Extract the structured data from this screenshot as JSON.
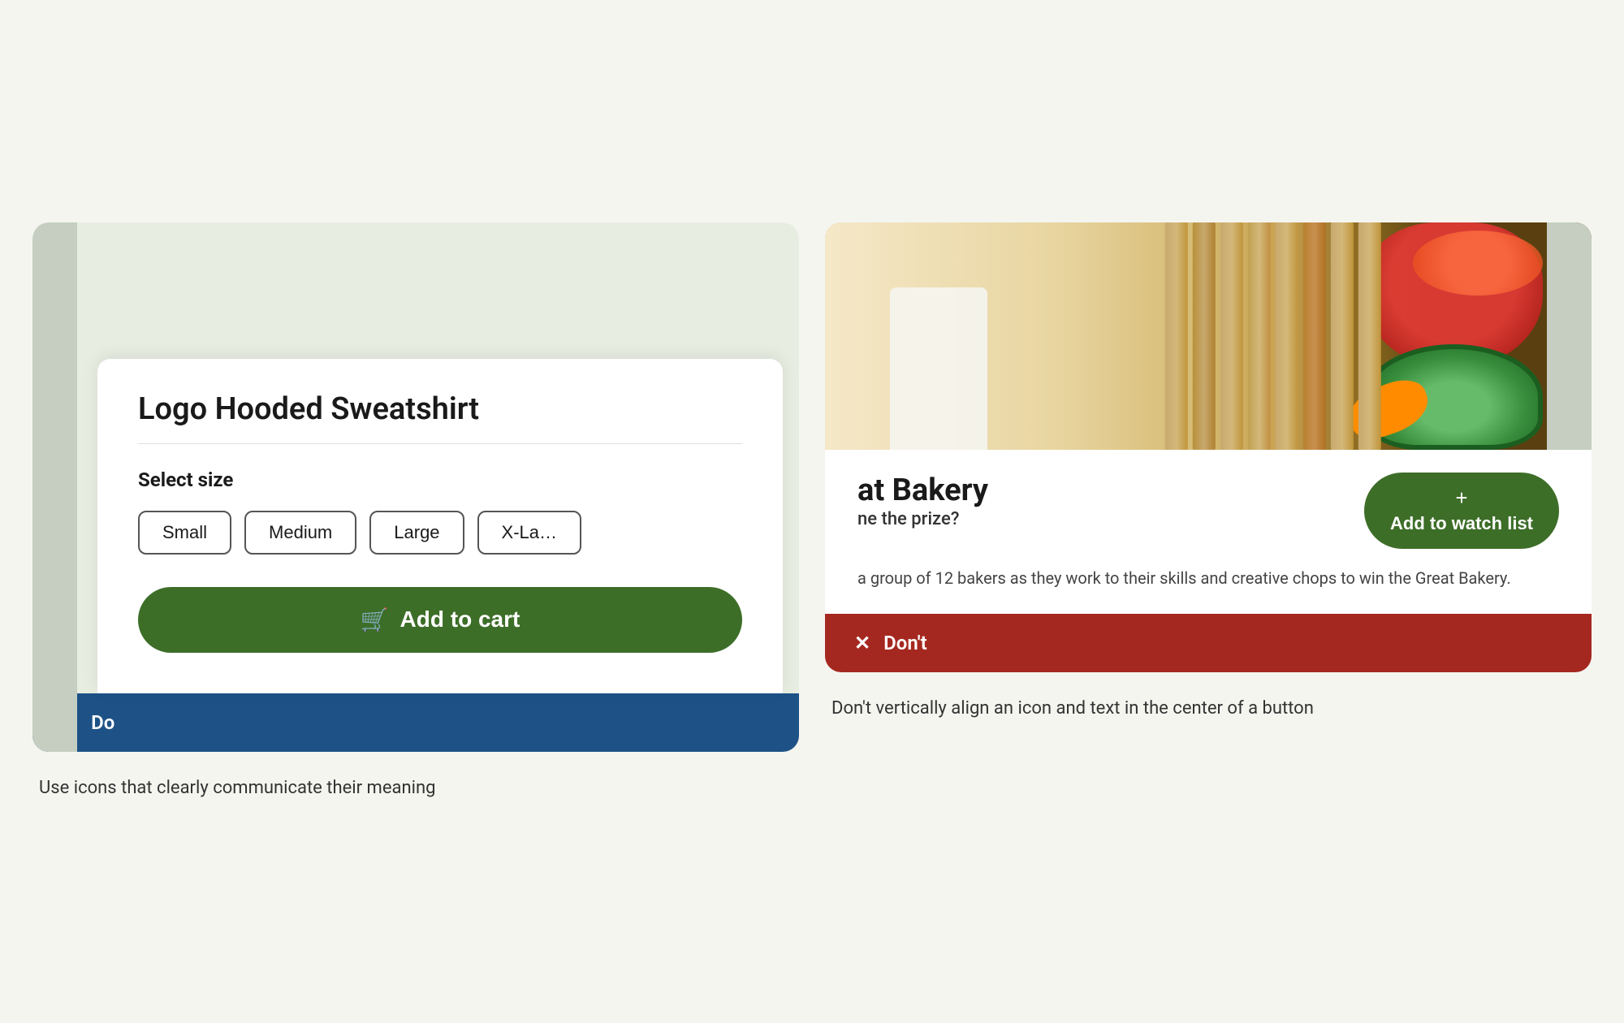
{
  "left_panel": {
    "card": {
      "product_title": "Logo Hooded Sweatshirt",
      "select_size_label": "Select size",
      "sizes": [
        "Small",
        "Medium",
        "Large",
        "X-La…"
      ],
      "add_to_cart_label": "Add to cart",
      "cart_icon": "🛒"
    },
    "label_bar": {
      "icon": "✓",
      "text": "Do"
    },
    "description": "Use icons that clearly communicate their meaning"
  },
  "right_panel": {
    "card": {
      "bakery_title": "at Bakery",
      "subtitle": "ne the prize?",
      "description": "a group of 12 bakers as they work to their skills and creative chops to win the Great Bakery.",
      "add_watch_plus": "+",
      "add_watch_label": "Add to watch list"
    },
    "label_bar": {
      "icon": "✕",
      "text": "Don't"
    },
    "description": "Don't vertically align an icon and text in the center of a button"
  }
}
